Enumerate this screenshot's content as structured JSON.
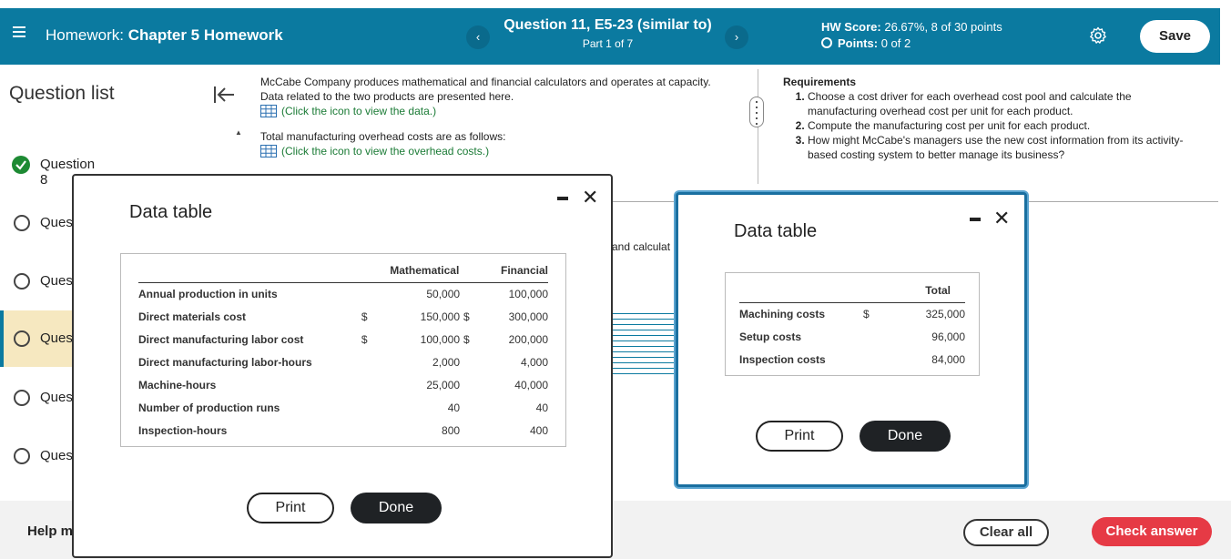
{
  "header": {
    "hw_label": "Homework:",
    "hw_name": "Chapter 5 Homework",
    "question_title": "Question 11, E5-23 (similar to)",
    "part": "Part 1 of 7",
    "prev_glyph": "‹",
    "next_glyph": "›",
    "hw_score_label": "HW Score:",
    "hw_score_value": "26.67%, 8 of 30 points",
    "points_label": "Points:",
    "points_value": "0 of 2",
    "save_label": "Save"
  },
  "sidebar": {
    "title": "Question list",
    "items": [
      {
        "label": "Question 8",
        "status": "correct"
      },
      {
        "label": "Ques"
      },
      {
        "label": "Ques"
      },
      {
        "label": "Ques"
      },
      {
        "label": "Ques"
      },
      {
        "label": "Ques"
      }
    ],
    "help": "Help m"
  },
  "problem": {
    "intro": "McCabe Company produces mathematical and financial calculators and operates at capacity. Data related to the two products are presented here.",
    "data_link": "(Click the icon to view the data.)",
    "overhead_text": "Total manufacturing overhead costs are as follows:",
    "overhead_link": "(Click the icon to view the overhead costs.)",
    "partial_text": "and calculat"
  },
  "requirements": {
    "title": "Requirements",
    "items": [
      "Choose a cost driver for each overhead cost pool and calculate the manufacturing overhead cost per unit for each product.",
      "Compute the manufacturing cost per unit for each product.",
      "How might McCabe's managers use the new cost information from its activity-based costing system to better manage its business?"
    ]
  },
  "modal1": {
    "title": "Data table",
    "col_math": "Mathematical",
    "col_fin": "Financial",
    "rows": [
      {
        "label": "Annual production in units",
        "cur1": "",
        "math": "50,000",
        "cur2": "",
        "fin": "100,000"
      },
      {
        "label": "Direct materials cost",
        "cur1": "$",
        "math": "150,000",
        "cur2": "$",
        "fin": "300,000"
      },
      {
        "label": "Direct manufacturing labor cost",
        "cur1": "$",
        "math": "100,000",
        "cur2": "$",
        "fin": "200,000"
      },
      {
        "label": "Direct manufacturing labor-hours",
        "cur1": "",
        "math": "2,000",
        "cur2": "",
        "fin": "4,000"
      },
      {
        "label": "Machine-hours",
        "cur1": "",
        "math": "25,000",
        "cur2": "",
        "fin": "40,000"
      },
      {
        "label": "Number of production runs",
        "cur1": "",
        "math": "40",
        "cur2": "",
        "fin": "40"
      },
      {
        "label": "Inspection-hours",
        "cur1": "",
        "math": "800",
        "cur2": "",
        "fin": "400"
      }
    ],
    "print_label": "Print",
    "done_label": "Done",
    "minimize_glyph": "▬",
    "close_glyph": "✕"
  },
  "modal2": {
    "title": "Data table",
    "col_total": "Total",
    "rows": [
      {
        "label": "Machining costs",
        "cur": "$",
        "total": "325,000"
      },
      {
        "label": "Setup costs",
        "cur": "",
        "total": "96,000"
      },
      {
        "label": "Inspection costs",
        "cur": "",
        "total": "84,000"
      }
    ],
    "print_label": "Print",
    "done_label": "Done",
    "close_glyph": "✕"
  },
  "footer": {
    "clear_label": "Clear all",
    "check_label": "Check answer"
  },
  "colors": {
    "header_bg": "#0b7aa0",
    "active_item_bg": "#f6e8c0",
    "check_button": "#e63a45",
    "link": "#1b7b36",
    "correct": "#1d8a33"
  }
}
